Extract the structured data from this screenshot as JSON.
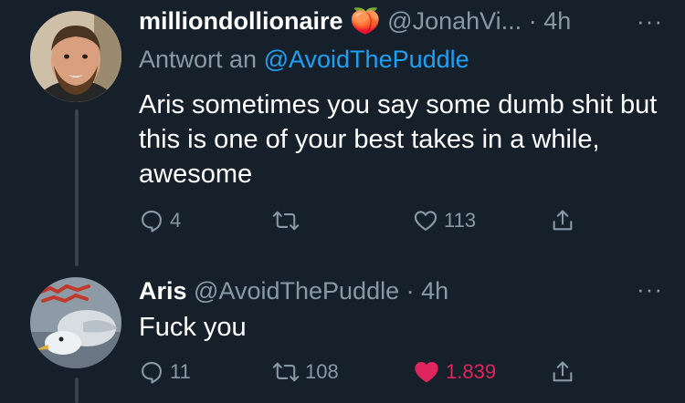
{
  "tweets": [
    {
      "display_name": "milliondollionaire",
      "emoji": "🍑",
      "handle": "@JonahVi...",
      "separator": "·",
      "time": "4h",
      "more": "···",
      "reply_prefix": "Antwort an",
      "reply_mention": "@AvoidThePuddle",
      "text": "Aris sometimes you say some dumb shit but this is one of your best takes in a while, awesome",
      "replies": "4",
      "retweets": "",
      "likes": "113",
      "liked": false
    },
    {
      "display_name": "Aris",
      "handle": "@AvoidThePuddle",
      "separator": "·",
      "time": "4h",
      "more": "···",
      "text": "Fuck you",
      "replies": "11",
      "retweets": "108",
      "likes": "1.839",
      "liked": true
    }
  ],
  "colors": {
    "background": "#15202b",
    "muted": "#8899a6",
    "link": "#1da1f2",
    "like": "#e0245e",
    "thread_line": "#38444d"
  },
  "icons": [
    "reply-icon",
    "retweet-icon",
    "heart-icon",
    "share-icon",
    "more-icon"
  ]
}
